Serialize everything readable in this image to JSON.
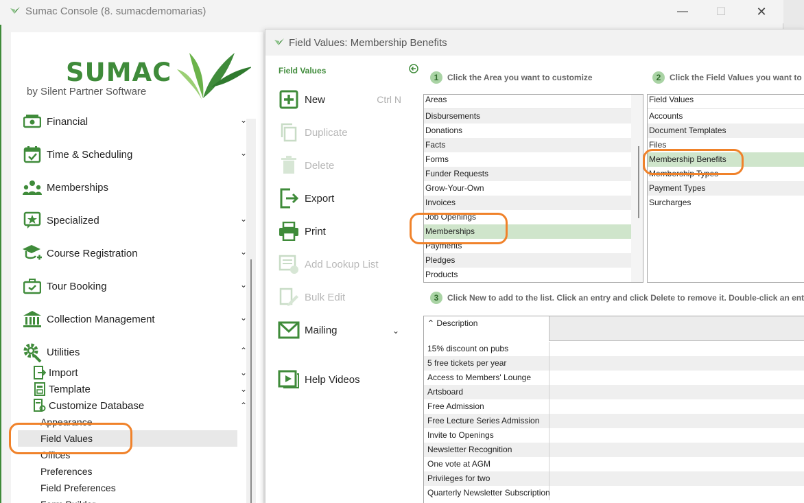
{
  "console": {
    "title": "Sumac Console (8. sumacdemomarias)",
    "min_symbol": "—",
    "max_symbol": "☐",
    "close_symbol": "✕"
  },
  "logo": {
    "word": "SUMAC",
    "sub": "by Silent Partner Software"
  },
  "sidebar": {
    "items": [
      {
        "label": "Financial",
        "icon": "money-icon",
        "chev": "⌄"
      },
      {
        "label": "Time & Scheduling",
        "icon": "calendar-check-icon",
        "chev": "⌄"
      },
      {
        "label": "Memberships",
        "icon": "people-group-icon",
        "chev": ""
      },
      {
        "label": "Specialized",
        "icon": "star-badge-icon",
        "chev": "⌄"
      },
      {
        "label": "Course Registration",
        "icon": "graduation-cap-icon",
        "chev": "⌄"
      },
      {
        "label": "Tour Booking",
        "icon": "briefcase-icon",
        "chev": "⌄"
      },
      {
        "label": "Collection Management",
        "icon": "museum-icon",
        "chev": "⌄"
      },
      {
        "label": "Utilities",
        "icon": "gear-wrench-icon",
        "chev": "⌃"
      }
    ],
    "utilities": [
      {
        "label": "Import",
        "icon": "import-icon",
        "chev": "⌄"
      },
      {
        "label": "Template",
        "icon": "template-icon",
        "chev": "⌄"
      },
      {
        "label": "Customize Database",
        "icon": "customize-database-icon",
        "chev": "⌃"
      }
    ],
    "customize": [
      "Appearance",
      "Field Values",
      "Offices",
      "Preferences",
      "Field Preferences",
      "Form Builder"
    ],
    "selected": "Field Values"
  },
  "dialog": {
    "title": "Field Values: Membership Benefits",
    "panel_heading": "Field Values",
    "tools": {
      "new": "New",
      "new_shortcut": "Ctrl N",
      "duplicate": "Duplicate",
      "delete": "Delete",
      "export": "Export",
      "print": "Print",
      "add_lookup": "Add Lookup List",
      "bulk_edit": "Bulk Edit",
      "mailing": "Mailing",
      "mailing_chev": "⌄",
      "help": "Help Videos"
    },
    "steps": {
      "one_num": "1",
      "one": "Click the Area you want to customize",
      "two_num": "2",
      "two": "Click the Field Values you want to edit",
      "three_num": "3",
      "three": "Click New to add to the list. Click an entry and click Delete to remove it. Double-click an entry to change"
    },
    "areas": {
      "header": "Areas",
      "items": [
        "Disbursements",
        "Donations",
        "Facts",
        "Forms",
        "Funder Requests",
        "Grow-Your-Own",
        "Invoices",
        "Job Openings",
        "Memberships",
        "Payments",
        "Pledges",
        "Products"
      ],
      "selected": "Memberships"
    },
    "field_values": {
      "header": "Field Values",
      "items": [
        "Accounts",
        "Document Templates",
        "Files",
        "Membership Benefits",
        "Membership Types",
        "Payment Types",
        "Surcharges"
      ],
      "selected": "Membership Benefits"
    },
    "grid": {
      "sort_symbol": "⌃",
      "header": "Description",
      "rows": [
        "15% discount on pubs",
        "5 free tickets per year",
        "Access to Members' Lounge",
        "Artsboard",
        "Free Admission",
        "Free Lecture Series Admission",
        "Invite to Openings",
        "Newsletter Recognition",
        "One vote at AGM",
        "Privileges for two",
        "Quarterly Newsletter Subscription"
      ]
    }
  },
  "colors": {
    "brand": "#3f8b3a",
    "selection": "#cfe5cb",
    "annotation": "#f0822a"
  }
}
